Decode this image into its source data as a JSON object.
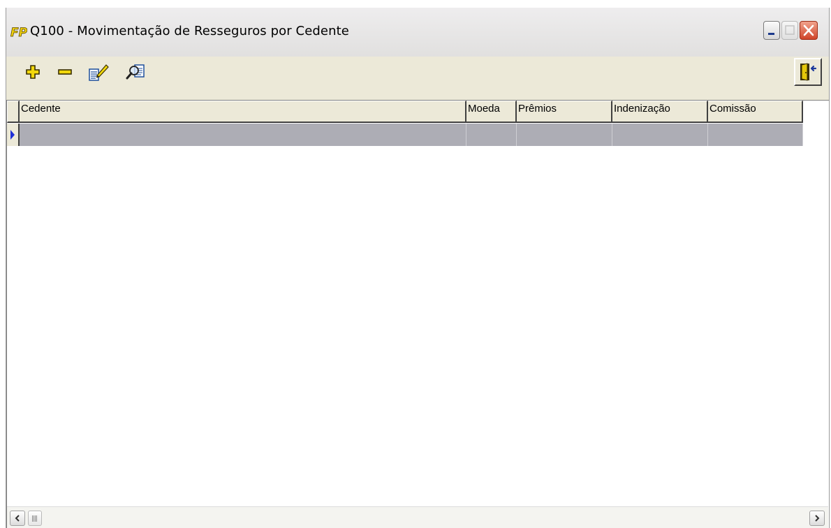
{
  "window": {
    "title": "Q100 - Movimentação de Resseguros por Cedente",
    "logo_text": "FP",
    "controls": [
      "minimize",
      "maximize",
      "close"
    ]
  },
  "toolbar": {
    "buttons": [
      {
        "name": "add",
        "icon": "plus-icon",
        "color": "#f2d80c"
      },
      {
        "name": "remove",
        "icon": "minus-icon",
        "color": "#f2d80c"
      },
      {
        "name": "edit",
        "icon": "edit-document-icon"
      },
      {
        "name": "search",
        "icon": "search-document-icon"
      },
      {
        "name": "exit",
        "icon": "exit-door-icon"
      }
    ]
  },
  "grid": {
    "columns": [
      "Cedente",
      "Moeda",
      "Prêmios",
      "Indenização",
      "Comissão"
    ],
    "rows": [
      {
        "cedente": "",
        "moeda": "",
        "premios": "",
        "indenizacao": "",
        "comissao": "",
        "current": true
      }
    ],
    "row_indicator": "current-row-arrow-icon",
    "selected_row_color": "#adadb5"
  }
}
